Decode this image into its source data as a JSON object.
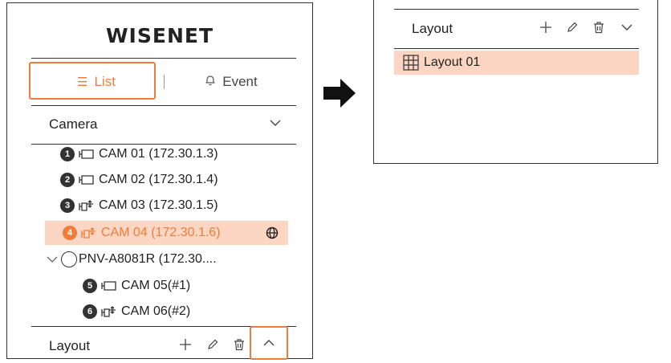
{
  "brand": {
    "logo_text": "WISENET"
  },
  "tabs": {
    "list_label": "List",
    "event_label": "Event",
    "active": "List"
  },
  "camera_section": {
    "title": "Camera"
  },
  "cameras": [
    {
      "number": "1",
      "label": "CAM 01 (172.30.1.3)",
      "icon": "fixed-camera-icon"
    },
    {
      "number": "2",
      "label": "CAM 02 (172.30.1.4)",
      "icon": "fixed-camera-icon"
    },
    {
      "number": "3",
      "label": "CAM 03 (172.30.1.5)",
      "icon": "ptz-camera-icon"
    },
    {
      "number": "4",
      "label": "CAM 04 (172.30.1.6)",
      "icon": "ptz-camera-icon",
      "selected": true
    }
  ],
  "group": {
    "label": "PNV-A8081R (172.30....",
    "children": [
      {
        "number": "5",
        "label": "CAM 05(#1)",
        "icon": "fixed-camera-icon"
      },
      {
        "number": "6",
        "label": "CAM 06(#2)",
        "icon": "ptz-camera-icon"
      }
    ]
  },
  "layout_section": {
    "title": "Layout"
  },
  "layout_panel": {
    "title": "Layout",
    "items": [
      {
        "label": "Layout 01",
        "selected": true
      }
    ]
  },
  "colors": {
    "accent": "#ee7d3c",
    "selected_bg": "#fcd6c2",
    "text": "#222222"
  }
}
